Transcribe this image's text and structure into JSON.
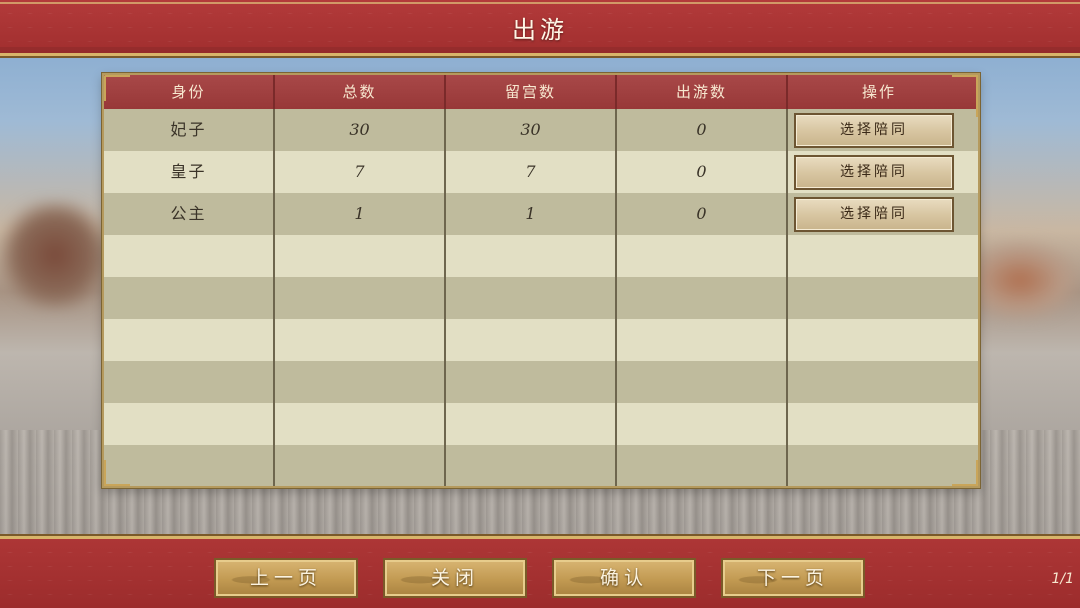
{
  "header": {
    "title": "出游"
  },
  "table": {
    "columns": [
      "身份",
      "总数",
      "留宫数",
      "出游数",
      "操作"
    ],
    "rows": [
      {
        "identity": "妃子",
        "total": "30",
        "stay": "30",
        "out": "0",
        "action": "选择陪同"
      },
      {
        "identity": "皇子",
        "total": "7",
        "stay": "7",
        "out": "0",
        "action": "选择陪同"
      },
      {
        "identity": "公主",
        "total": "1",
        "stay": "1",
        "out": "0",
        "action": "选择陪同"
      }
    ]
  },
  "footer": {
    "prev_label": "上一页",
    "close_label": "关闭",
    "confirm_label": "确认",
    "next_label": "下一页",
    "page_counter": "1/1"
  },
  "colors": {
    "banner_red": "#a83434",
    "trim_gold": "#d8b56a",
    "header_cell": "#a84848",
    "row_dark": "#bfbb9d",
    "row_light": "#e2dfc4"
  }
}
